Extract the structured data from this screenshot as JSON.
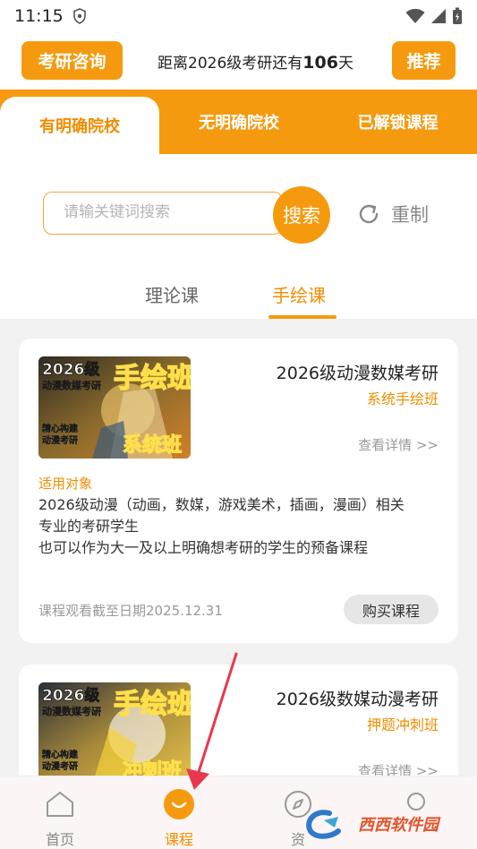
{
  "status_bar": {
    "time": "11:15"
  },
  "header": {
    "consult_label": "考研咨询",
    "countdown_prefix": "距离2026级考研还有",
    "countdown_days": "106",
    "countdown_suffix": "天",
    "recommend_label": "推荐"
  },
  "tabs": [
    {
      "label": "有明确院校",
      "active": true
    },
    {
      "label": "无明确院校",
      "active": false
    },
    {
      "label": "已解锁课程",
      "active": false
    }
  ],
  "search": {
    "placeholder": "请输关键词搜索",
    "button_label": "搜索",
    "reset_label": "重制"
  },
  "subtabs": [
    {
      "label": "理论课",
      "active": false
    },
    {
      "label": "手绘课",
      "active": true
    }
  ],
  "courses": [
    {
      "thumb_year": "2026级",
      "thumb_line1": "动漫数媒考研",
      "thumb_big": "手绘班",
      "thumb_side1": "精心构建",
      "thumb_side2": "动漫考研",
      "thumb_tag": "系统班",
      "title": "2026级动漫数媒考研",
      "subtitle": "系统手绘班",
      "detail_label": "查看详情 >>",
      "target_label": "适用对象",
      "desc_lines": [
        "2026级动漫（动画，数媒，游戏美术，插画，漫画）相关",
        "专业的考研学生",
        "也可以作为大一及以上明确想考研的学生的预备课程"
      ],
      "deadline": "课程观看截至日期2025.12.31",
      "buy_label": "购买课程"
    },
    {
      "thumb_year": "2026级",
      "thumb_line1": "动漫数媒考研",
      "thumb_big": "手绘班",
      "thumb_side1": "精心构建",
      "thumb_side2": "动漫考研",
      "thumb_tag": "冲刺班",
      "title": "2026级数媒动漫考研",
      "subtitle": "押题冲刺班",
      "detail_label": "查看详情 >>"
    }
  ],
  "bottom_nav": [
    {
      "label": "首页",
      "icon": "home-icon",
      "active": false
    },
    {
      "label": "课程",
      "icon": "course-smile-icon",
      "active": true
    },
    {
      "label": "资",
      "icon": "compass-icon",
      "active": false
    },
    {
      "label": "",
      "icon": "profile-icon",
      "active": false
    }
  ],
  "watermark": {
    "text": "西西软件园",
    "sub": "CR173.COM"
  },
  "colors": {
    "accent": "#f59a0e",
    "accent_text": "#f08d00",
    "arrow": "#e8384f"
  }
}
